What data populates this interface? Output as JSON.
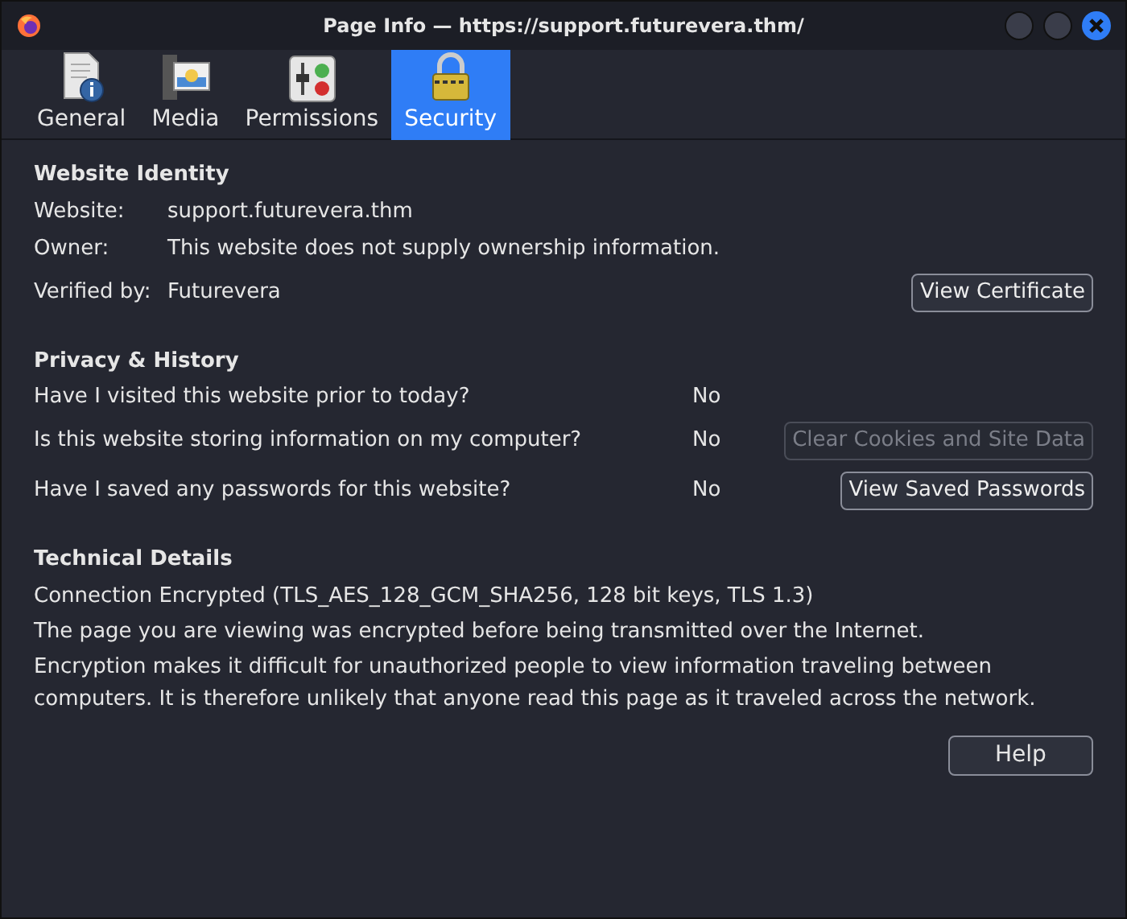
{
  "window": {
    "title": "Page Info — https://support.futurevera.thm/"
  },
  "tabs": [
    {
      "label": "General",
      "kind": "general",
      "selected": false
    },
    {
      "label": "Media",
      "kind": "media",
      "selected": false
    },
    {
      "label": "Permissions",
      "kind": "permissions",
      "selected": false
    },
    {
      "label": "Security",
      "kind": "security",
      "selected": true
    }
  ],
  "identity": {
    "heading": "Website Identity",
    "rows": [
      {
        "label": "Website:",
        "value": "support.futurevera.thm"
      },
      {
        "label": "Owner:",
        "value": "This website does not supply ownership information."
      },
      {
        "label": "Verified by:",
        "value": "Futurevera",
        "button": {
          "label": "View Certificate",
          "disabled": false
        }
      }
    ]
  },
  "privacy": {
    "heading": "Privacy & History",
    "rows": [
      {
        "question": "Have I visited this website prior to today?",
        "answer": "No"
      },
      {
        "question": "Is this website storing information on my computer?",
        "answer": "No",
        "button": {
          "label": "Clear Cookies and Site Data",
          "disabled": true
        }
      },
      {
        "question": "Have I saved any passwords for this website?",
        "answer": "No",
        "button": {
          "label": "View Saved Passwords",
          "disabled": false
        }
      }
    ]
  },
  "technical": {
    "heading": "Technical Details",
    "lines": [
      "Connection Encrypted (TLS_AES_128_GCM_SHA256, 128 bit keys, TLS 1.3)",
      "The page you are viewing was encrypted before being transmitted over the Internet.",
      "Encryption makes it difficult for unauthorized people to view information traveling between computers. It is therefore unlikely that anyone read this page as it traveled across the network."
    ]
  },
  "help_button": "Help"
}
